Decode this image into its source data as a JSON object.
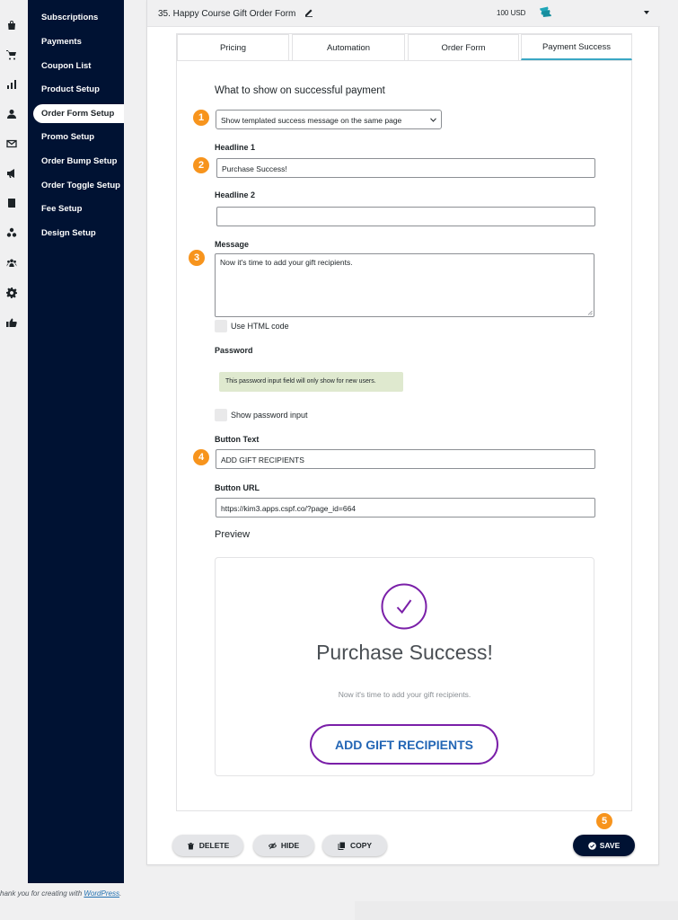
{
  "sidebar": {
    "items": [
      {
        "label": "Subscriptions"
      },
      {
        "label": "Payments"
      },
      {
        "label": "Coupon List"
      },
      {
        "label": "Product Setup"
      },
      {
        "label": "Order Form Setup"
      },
      {
        "label": "Promo Setup"
      },
      {
        "label": "Order Bump Setup"
      },
      {
        "label": "Order Toggle Setup"
      },
      {
        "label": "Fee Setup"
      },
      {
        "label": "Design Setup"
      }
    ],
    "active": "Order Form Setup"
  },
  "icons": {
    "rail": [
      "shopping-bag-icon",
      "cart-icon",
      "bar-chart-icon",
      "user-icon",
      "envelope-icon",
      "megaphone-icon",
      "book-icon",
      "cubes-icon",
      "users-icon",
      "gear-icon",
      "thumbs-up-icon"
    ]
  },
  "form": {
    "title": "35. Happy Course Gift Order Form",
    "price": "100 USD"
  },
  "tabs": [
    {
      "label": "Pricing"
    },
    {
      "label": "Automation"
    },
    {
      "label": "Order Form"
    },
    {
      "label": "Payment Success"
    }
  ],
  "active_tab": "Payment Success",
  "success": {
    "heading": "What to show on successful payment",
    "select_value": "Show templated success message on the same page",
    "headline1_label": "Headline 1",
    "headline1_value": "Purchase Success!",
    "headline2_label": "Headline 2",
    "headline2_value": "",
    "message_label": "Message",
    "message_value": "Now it's time to add your gift recipients.",
    "use_html_label": "Use HTML code",
    "password_label": "Password",
    "password_notice": "This password input field will only show for new users.",
    "show_password_label": "Show password input",
    "button_text_label": "Button Text",
    "button_text_value": "ADD GIFT RECIPIENTS",
    "button_url_label": "Button URL",
    "button_url_value": "https://kim3.apps.cspf.co/?page_id=664",
    "preview_label": "Preview"
  },
  "preview": {
    "headline": "Purchase Success!",
    "message": "Now it's time to add your gift recipients.",
    "button": "ADD GIFT RECIPIENTS"
  },
  "actions": {
    "delete": "DELETE",
    "hide": "HIDE",
    "copy": "COPY",
    "save": "SAVE"
  },
  "badges": [
    "1",
    "2",
    "3",
    "4",
    "5"
  ],
  "footer": {
    "text": "hank you for creating with ",
    "link": "WordPress",
    "suffix": "."
  },
  "colors": {
    "sidebar_bg": "#001233",
    "accent_tab": "#3aa7c4",
    "badge": "#f7941d",
    "preview_button_border": "#7a1fa8",
    "preview_button_text": "#2366b5",
    "preview_check": "#7a1fa8",
    "notice_bg": "#dfe9cf",
    "ticket": "#1fa6b8"
  }
}
